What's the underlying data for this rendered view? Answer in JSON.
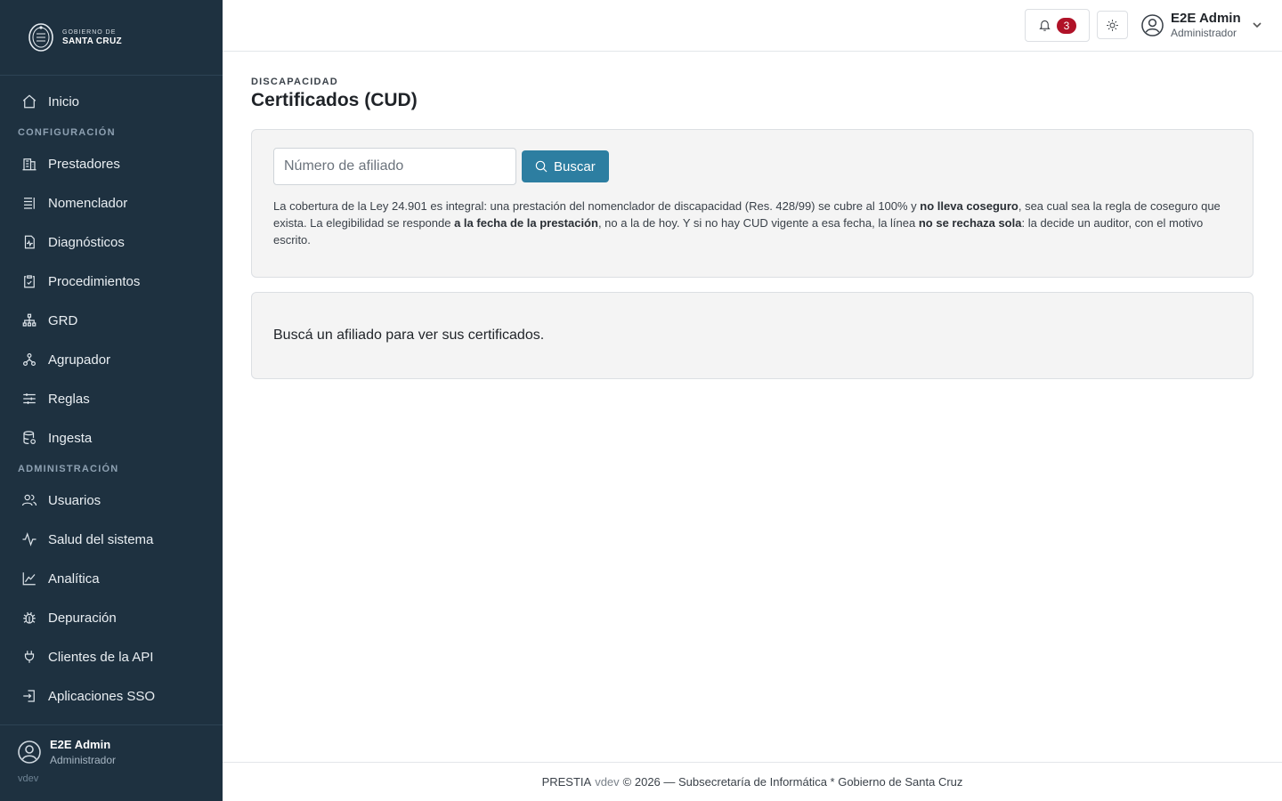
{
  "brand": {
    "line1": "GOBIERNO DE",
    "line2": "SANTA CRUZ"
  },
  "sidebar": {
    "home": {
      "label": "Inicio",
      "icon": "home-icon"
    },
    "section_config": "CONFIGURACIÓN",
    "config_items": [
      {
        "label": "Prestadores",
        "icon": "building-icon"
      },
      {
        "label": "Nomenclador",
        "icon": "list-icon"
      },
      {
        "label": "Diagnósticos",
        "icon": "file-pulse-icon"
      },
      {
        "label": "Procedimientos",
        "icon": "clipboard-check-icon"
      },
      {
        "label": "GRD",
        "icon": "hierarchy-icon"
      },
      {
        "label": "Agrupador",
        "icon": "group-icon"
      },
      {
        "label": "Reglas",
        "icon": "sliders-icon"
      },
      {
        "label": "Ingesta",
        "icon": "database-icon"
      }
    ],
    "section_admin": "ADMINISTRACIÓN",
    "admin_items": [
      {
        "label": "Usuarios",
        "icon": "users-icon"
      },
      {
        "label": "Salud del sistema",
        "icon": "activity-icon"
      },
      {
        "label": "Analítica",
        "icon": "chart-line-icon"
      },
      {
        "label": "Depuración",
        "icon": "bug-icon"
      },
      {
        "label": "Clientes de la API",
        "icon": "plug-icon"
      },
      {
        "label": "Aplicaciones SSO",
        "icon": "login-icon"
      }
    ],
    "user": {
      "name": "E2E Admin",
      "role": "Administrador"
    },
    "version": "vdev"
  },
  "topbar": {
    "notifications_count": "3",
    "user": {
      "name": "E2E Admin",
      "role": "Administrador"
    }
  },
  "page": {
    "eyebrow": "DISCAPACIDAD",
    "title": "Certificados (CUD)"
  },
  "search": {
    "placeholder": "Número de afiliado",
    "value": "",
    "button_label": "Buscar"
  },
  "info": {
    "p1": "La cobertura de la Ley 24.901 es integral: una prestación del nomenclador de discapacidad (Res. 428/99) se cubre al 100% y ",
    "b1": "no lleva coseguro",
    "p2": ", sea cual sea la regla de coseguro que exista. La elegibilidad se responde ",
    "b2": "a la fecha de la prestación",
    "p3": ", no a la de hoy. Y si no hay CUD vigente a esa fecha, la línea ",
    "b3": "no se rechaza sola",
    "p4": ": la decide un auditor, con el motivo escrito."
  },
  "empty_state": "Buscá un afiliado para ver sus certificados.",
  "footer": {
    "app": "PRESTIA",
    "version": "vdev",
    "rest": "© 2026 — Subsecretaría de Informática * Gobierno de Santa Cruz"
  },
  "colors": {
    "sidebar_bg": "#1e3140",
    "primary": "#2d7ea1",
    "badge": "#b01228",
    "card_bg": "#f4f4f4"
  }
}
